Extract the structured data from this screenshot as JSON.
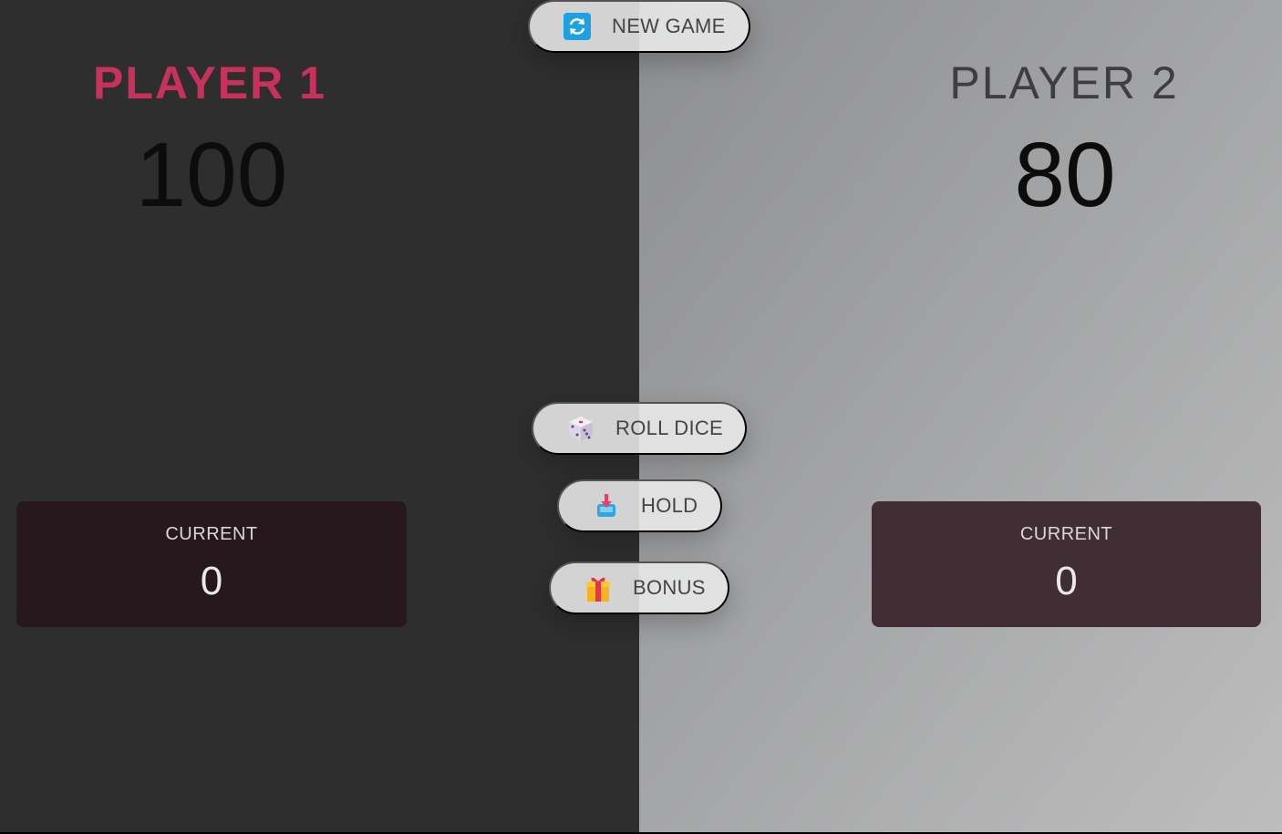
{
  "players": [
    {
      "name": "PLAYER 1",
      "score": "100",
      "current_label": "CURRENT",
      "current": "0",
      "active": true
    },
    {
      "name": "PLAYER 2",
      "score": "80",
      "current_label": "CURRENT",
      "current": "0",
      "active": false
    }
  ],
  "controls": {
    "new_game": {
      "label": "NEW GAME",
      "icon": "refresh-icon"
    },
    "roll_dice": {
      "label": "ROLL DICE",
      "icon": "dice-icon"
    },
    "hold": {
      "label": "HOLD",
      "icon": "inbox-download-icon"
    },
    "bonus": {
      "label": "BONUS",
      "icon": "gift-icon"
    }
  },
  "colors": {
    "active_player": "#c7325d",
    "left_panel": "#2e2e2e",
    "right_panel_gradient": [
      "#8d8e90",
      "#bdbdbd"
    ]
  }
}
